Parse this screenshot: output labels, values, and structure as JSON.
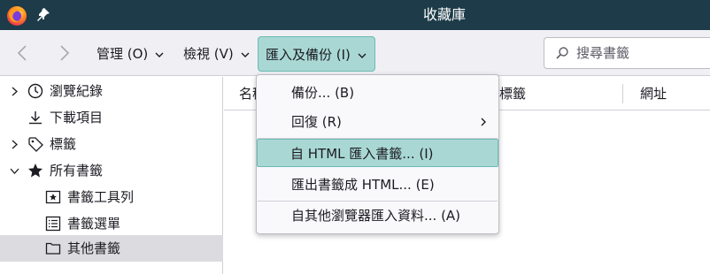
{
  "window": {
    "title": "收藏庫"
  },
  "toolbar": {
    "organize_label": "管理 (O)",
    "views_label": "檢視 (V)",
    "import_backup_label": "匯入及備份 (I)",
    "search_placeholder": "搜尋書籤"
  },
  "sidebar": {
    "items": [
      {
        "label": "瀏覽紀錄",
        "icon": "history-clock-icon"
      },
      {
        "label": "下載項目",
        "icon": "download-icon"
      },
      {
        "label": "標籤",
        "icon": "tag-icon"
      },
      {
        "label": "所有書籤",
        "icon": "star-icon"
      },
      {
        "label": "書籤工具列",
        "icon": "bookmarks-toolbar-icon"
      },
      {
        "label": "書籤選單",
        "icon": "bookmarks-menu-icon"
      },
      {
        "label": "其他書籤",
        "icon": "folder-icon"
      }
    ]
  },
  "columns": {
    "name": "名稱",
    "tags": "標籤",
    "location": "網址"
  },
  "menu": {
    "items": [
      {
        "label": "備份... (B)"
      },
      {
        "label": "回復 (R)",
        "submenu": true
      },
      {
        "label": "自 HTML 匯入書籤... (I)"
      },
      {
        "label": "匯出書籤成 HTML... (E)"
      },
      {
        "label": "自其他瀏覽器匯入資料... (A)"
      }
    ]
  },
  "colors": {
    "titlebar": "#1d3b48",
    "toolbar": "#f0f0f4",
    "accent_highlight": "#a9d8d4",
    "selected_row": "#dcdce0"
  }
}
